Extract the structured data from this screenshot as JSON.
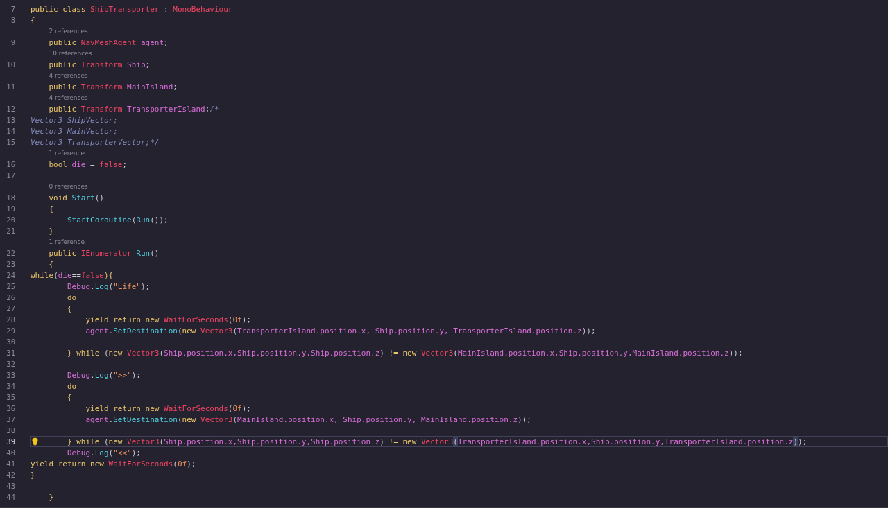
{
  "editor": {
    "lines": [
      {
        "kind": "code",
        "number": "7",
        "current": false,
        "tokens": [
          {
            "text": "public class ",
            "kind": "keyword"
          },
          {
            "text": "ShipTransporter",
            "kind": "type"
          },
          {
            "text": " : ",
            "kind": "punct"
          },
          {
            "text": "MonoBehaviour",
            "kind": "type"
          }
        ]
      },
      {
        "kind": "code",
        "number": "8",
        "current": false,
        "tokens": [
          {
            "text": "{",
            "kind": "brace"
          }
        ]
      },
      {
        "kind": "codelens",
        "text": "2 references"
      },
      {
        "kind": "code",
        "number": "9",
        "current": false,
        "tokens": [
          {
            "text": "    public ",
            "kind": "keyword"
          },
          {
            "text": "NavMeshAgent",
            "kind": "type"
          },
          {
            "text": " agent",
            "kind": "member"
          },
          {
            "text": ";",
            "kind": "punct"
          }
        ]
      },
      {
        "kind": "codelens",
        "text": "10 references"
      },
      {
        "kind": "code",
        "number": "10",
        "current": false,
        "tokens": [
          {
            "text": "    public ",
            "kind": "keyword"
          },
          {
            "text": "Transform",
            "kind": "type"
          },
          {
            "text": " Ship",
            "kind": "member"
          },
          {
            "text": ";",
            "kind": "punct"
          }
        ]
      },
      {
        "kind": "codelens",
        "text": "4 references"
      },
      {
        "kind": "code",
        "number": "11",
        "current": false,
        "tokens": [
          {
            "text": "    public ",
            "kind": "keyword"
          },
          {
            "text": "Transform",
            "kind": "type"
          },
          {
            "text": " MainIsland",
            "kind": "member"
          },
          {
            "text": ";",
            "kind": "punct"
          }
        ]
      },
      {
        "kind": "codelens",
        "text": "4 references"
      },
      {
        "kind": "code",
        "number": "12",
        "current": false,
        "tokens": [
          {
            "text": "    public ",
            "kind": "keyword"
          },
          {
            "text": "Transform",
            "kind": "type"
          },
          {
            "text": " TransporterIsland",
            "kind": "member"
          },
          {
            "text": ";",
            "kind": "punct"
          },
          {
            "text": "/*",
            "kind": "comment"
          }
        ]
      },
      {
        "kind": "code",
        "number": "13",
        "current": false,
        "tokens": [
          {
            "text": "Vector3 ShipVector;",
            "kind": "comment"
          }
        ]
      },
      {
        "kind": "code",
        "number": "14",
        "current": false,
        "tokens": [
          {
            "text": "Vector3 MainVector;",
            "kind": "comment"
          }
        ]
      },
      {
        "kind": "code",
        "number": "15",
        "current": false,
        "tokens": [
          {
            "text": "Vector3 TransporterVector;*/",
            "kind": "comment"
          }
        ]
      },
      {
        "kind": "codelens",
        "text": "1 reference"
      },
      {
        "kind": "code",
        "number": "16",
        "current": false,
        "tokens": [
          {
            "text": "    bool ",
            "kind": "keyword"
          },
          {
            "text": "die",
            "kind": "member"
          },
          {
            "text": " = ",
            "kind": "punct"
          },
          {
            "text": "false",
            "kind": "type"
          },
          {
            "text": ";",
            "kind": "punct"
          }
        ]
      },
      {
        "kind": "code",
        "number": "17",
        "current": false
      },
      {
        "kind": "codelens",
        "text": "0 references"
      },
      {
        "kind": "code",
        "number": "18",
        "current": false,
        "tokens": [
          {
            "text": "    void ",
            "kind": "keyword"
          },
          {
            "text": "Start",
            "kind": "function"
          },
          {
            "text": "()",
            "kind": "punct"
          }
        ]
      },
      {
        "kind": "code",
        "number": "19",
        "current": false,
        "tokens": [
          {
            "text": "    {",
            "kind": "brace"
          }
        ]
      },
      {
        "kind": "code",
        "number": "20",
        "current": false,
        "tokens": [
          {
            "text": "        StartCoroutine",
            "kind": "function"
          },
          {
            "text": "(",
            "kind": "punct"
          },
          {
            "text": "Run",
            "kind": "function"
          },
          {
            "text": "());",
            "kind": "punct"
          }
        ]
      },
      {
        "kind": "code",
        "number": "21",
        "current": false,
        "tokens": [
          {
            "text": "    }",
            "kind": "brace"
          }
        ]
      },
      {
        "kind": "codelens",
        "text": "1 reference"
      },
      {
        "kind": "code",
        "number": "22",
        "current": false,
        "tokens": [
          {
            "text": "    public ",
            "kind": "keyword"
          },
          {
            "text": "IEnumerator",
            "kind": "type"
          },
          {
            "text": " Run",
            "kind": "function"
          },
          {
            "text": "()",
            "kind": "punct"
          }
        ]
      },
      {
        "kind": "code",
        "number": "23",
        "current": false,
        "tokens": [
          {
            "text": "    {",
            "kind": "brace"
          }
        ]
      },
      {
        "kind": "code",
        "number": "24",
        "current": false,
        "tokens": [
          {
            "text": "while",
            "kind": "keyword"
          },
          {
            "text": "(",
            "kind": "punct"
          },
          {
            "text": "die",
            "kind": "member"
          },
          {
            "text": "==",
            "kind": "punct"
          },
          {
            "text": "false",
            "kind": "type"
          },
          {
            "text": "){",
            "kind": "brace"
          }
        ]
      },
      {
        "kind": "code",
        "number": "25",
        "current": false,
        "tokens": [
          {
            "text": "        Debug",
            "kind": "member"
          },
          {
            "text": ".",
            "kind": "punct"
          },
          {
            "text": "Log",
            "kind": "function"
          },
          {
            "text": "(",
            "kind": "punct"
          },
          {
            "text": "\"Life\"",
            "kind": "string"
          },
          {
            "text": ");",
            "kind": "punct"
          }
        ]
      },
      {
        "kind": "code",
        "number": "26",
        "current": false,
        "tokens": [
          {
            "text": "        do",
            "kind": "keyword"
          }
        ]
      },
      {
        "kind": "code",
        "number": "27",
        "current": false,
        "tokens": [
          {
            "text": "        {",
            "kind": "brace"
          }
        ]
      },
      {
        "kind": "code",
        "number": "28",
        "current": false,
        "tokens": [
          {
            "text": "            yield return new ",
            "kind": "keyword"
          },
          {
            "text": "WaitForSeconds",
            "kind": "type"
          },
          {
            "text": "(",
            "kind": "punct"
          },
          {
            "text": "0f",
            "kind": "number"
          },
          {
            "text": ");",
            "kind": "punct"
          }
        ]
      },
      {
        "kind": "code",
        "number": "29",
        "current": false,
        "tokens": [
          {
            "text": "            agent",
            "kind": "member"
          },
          {
            "text": ".",
            "kind": "punct"
          },
          {
            "text": "SetDestination",
            "kind": "function"
          },
          {
            "text": "(",
            "kind": "punct"
          },
          {
            "text": "new ",
            "kind": "keyword"
          },
          {
            "text": "Vector3",
            "kind": "type"
          },
          {
            "text": "(",
            "kind": "punct"
          },
          {
            "text": "TransporterIsland.position.x, Ship.position.y, TransporterIsland.position.z",
            "kind": "member"
          },
          {
            "text": "));",
            "kind": "punct"
          }
        ]
      },
      {
        "kind": "code",
        "number": "30",
        "current": false
      },
      {
        "kind": "code",
        "number": "31",
        "current": false,
        "tokens": [
          {
            "text": "        } ",
            "kind": "brace"
          },
          {
            "text": "while ",
            "kind": "keyword"
          },
          {
            "text": "(",
            "kind": "punct"
          },
          {
            "text": "new ",
            "kind": "keyword"
          },
          {
            "text": "Vector3",
            "kind": "type"
          },
          {
            "text": "(",
            "kind": "punct"
          },
          {
            "text": "Ship.position.x,Ship.position.y,Ship.position.z",
            "kind": "member"
          },
          {
            "text": ") ",
            "kind": "punct"
          },
          {
            "text": "!= new ",
            "kind": "keyword"
          },
          {
            "text": "Vector3",
            "kind": "type"
          },
          {
            "text": "(",
            "kind": "punct"
          },
          {
            "text": "MainIsland.position.x,Ship.position.y,MainIsland.position.z",
            "kind": "member"
          },
          {
            "text": "));",
            "kind": "punct"
          }
        ]
      },
      {
        "kind": "code",
        "number": "32",
        "current": false
      },
      {
        "kind": "code",
        "number": "33",
        "current": false,
        "tokens": [
          {
            "text": "        Debug",
            "kind": "member"
          },
          {
            "text": ".",
            "kind": "punct"
          },
          {
            "text": "Log",
            "kind": "function"
          },
          {
            "text": "(",
            "kind": "punct"
          },
          {
            "text": "\">>\"",
            "kind": "string"
          },
          {
            "text": ");",
            "kind": "punct"
          }
        ]
      },
      {
        "kind": "code",
        "number": "34",
        "current": false,
        "tokens": [
          {
            "text": "        do",
            "kind": "keyword"
          }
        ]
      },
      {
        "kind": "code",
        "number": "35",
        "current": false,
        "tokens": [
          {
            "text": "        {",
            "kind": "brace"
          }
        ]
      },
      {
        "kind": "code",
        "number": "36",
        "current": false,
        "tokens": [
          {
            "text": "            yield return new ",
            "kind": "keyword"
          },
          {
            "text": "WaitForSeconds",
            "kind": "type"
          },
          {
            "text": "(",
            "kind": "punct"
          },
          {
            "text": "0f",
            "kind": "number"
          },
          {
            "text": ");",
            "kind": "punct"
          }
        ]
      },
      {
        "kind": "code",
        "number": "37",
        "current": false,
        "tokens": [
          {
            "text": "            agent",
            "kind": "member"
          },
          {
            "text": ".",
            "kind": "punct"
          },
          {
            "text": "SetDestination",
            "kind": "function"
          },
          {
            "text": "(",
            "kind": "punct"
          },
          {
            "text": "new ",
            "kind": "keyword"
          },
          {
            "text": "Vector3",
            "kind": "type"
          },
          {
            "text": "(",
            "kind": "punct"
          },
          {
            "text": "MainIsland.position.x, Ship.position.y, MainIsland.position.z",
            "kind": "member"
          },
          {
            "text": "));",
            "kind": "punct"
          }
        ]
      },
      {
        "kind": "code",
        "number": "38",
        "current": false
      },
      {
        "kind": "code",
        "number": "39",
        "current": true,
        "tokens": [
          {
            "text": "        } ",
            "kind": "brace"
          },
          {
            "text": "while ",
            "kind": "keyword"
          },
          {
            "text": "(",
            "kind": "punct"
          },
          {
            "text": "new ",
            "kind": "keyword"
          },
          {
            "text": "Vector3",
            "kind": "type"
          },
          {
            "text": "(",
            "kind": "punct"
          },
          {
            "text": "Ship.position.x,Ship.position.y,Ship.position.z",
            "kind": "member"
          },
          {
            "text": ") ",
            "kind": "punct"
          },
          {
            "text": "!= new ",
            "kind": "keyword"
          },
          {
            "text": "Vector3",
            "kind": "type"
          },
          {
            "text": "(",
            "kind": "match"
          },
          {
            "text": "TransporterIsland.position.x,Ship.position.y,TransporterIsland.position.z",
            "kind": "member"
          },
          {
            "text": ")",
            "kind": "match"
          },
          {
            "text": ");",
            "kind": "punct"
          }
        ]
      },
      {
        "kind": "code",
        "number": "40",
        "current": false,
        "tokens": [
          {
            "text": "        Debug",
            "kind": "member"
          },
          {
            "text": ".",
            "kind": "punct"
          },
          {
            "text": "Log",
            "kind": "function"
          },
          {
            "text": "(",
            "kind": "punct"
          },
          {
            "text": "\"<<\"",
            "kind": "string"
          },
          {
            "text": ");",
            "kind": "punct"
          }
        ]
      },
      {
        "kind": "code",
        "number": "41",
        "current": false,
        "tokens": [
          {
            "text": "yield return new ",
            "kind": "keyword"
          },
          {
            "text": "WaitForSeconds",
            "kind": "type"
          },
          {
            "text": "(",
            "kind": "punct"
          },
          {
            "text": "0f",
            "kind": "number"
          },
          {
            "text": ");",
            "kind": "punct"
          }
        ]
      },
      {
        "kind": "code",
        "number": "42",
        "current": false,
        "tokens": [
          {
            "text": "}",
            "kind": "brace"
          }
        ]
      },
      {
        "kind": "code",
        "number": "43",
        "current": false
      },
      {
        "kind": "code",
        "number": "44",
        "current": false,
        "tokens": [
          {
            "text": "    }",
            "kind": "brace"
          }
        ]
      }
    ]
  }
}
